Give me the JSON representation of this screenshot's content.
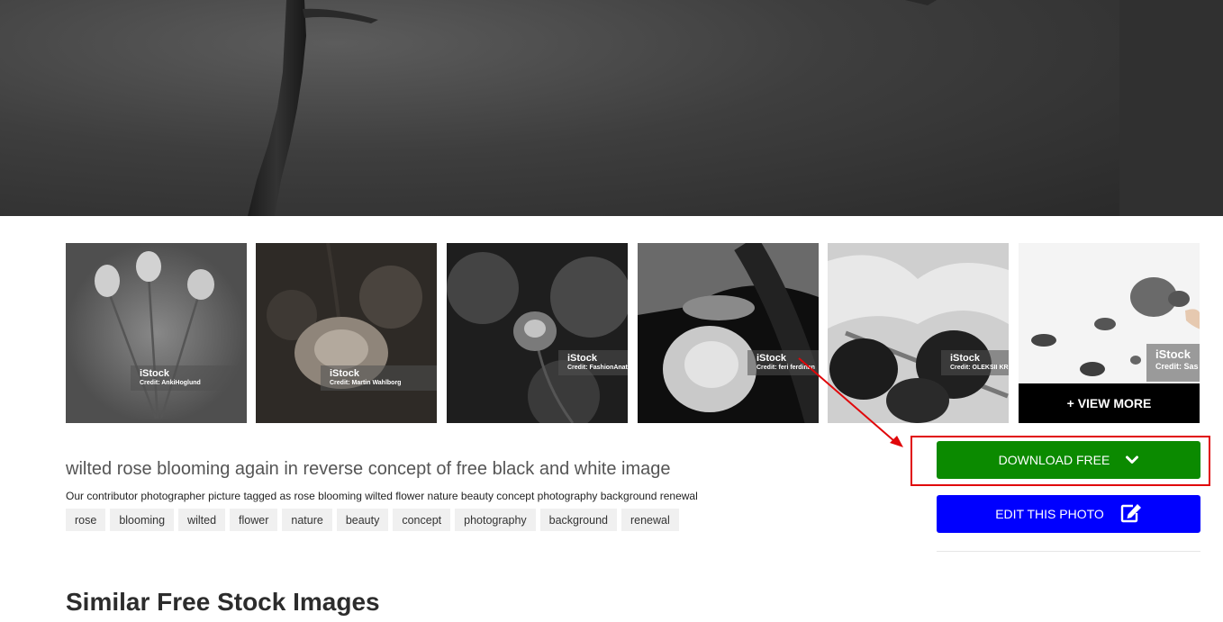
{
  "thumbnails": [
    {
      "brand": "iStock",
      "credit": "Credit: AnkiHoglund"
    },
    {
      "brand": "iStock",
      "credit": "Credit: Martin Wahlborg"
    },
    {
      "brand": "iStock",
      "credit": "Credit: FashionAnato"
    },
    {
      "brand": "iStock",
      "credit": "Credit: feri ferdinan"
    },
    {
      "brand": "iStock",
      "credit": "Credit: OLEKSII KR"
    },
    {
      "brand": "iStock",
      "credit": "Credit: Sas"
    }
  ],
  "view_more_label": "+ VIEW MORE",
  "photo": {
    "title": "wilted rose blooming again in reverse concept of free black and white image",
    "description": "Our contributor photographer picture tagged as rose blooming wilted flower nature beauty concept photography background renewal",
    "tags": [
      "rose",
      "blooming",
      "wilted",
      "flower",
      "nature",
      "beauty",
      "concept",
      "photography",
      "background",
      "renewal"
    ]
  },
  "buttons": {
    "download_label": "DOWNLOAD FREE",
    "download_icon": "chevron-down-icon",
    "edit_label": "EDIT THIS PHOTO",
    "edit_icon": "edit-icon"
  },
  "colors": {
    "download": "#0b8a00",
    "edit": "#0000ff",
    "highlight": "#e0070a"
  },
  "similar_title": "Similar Free Stock Images"
}
